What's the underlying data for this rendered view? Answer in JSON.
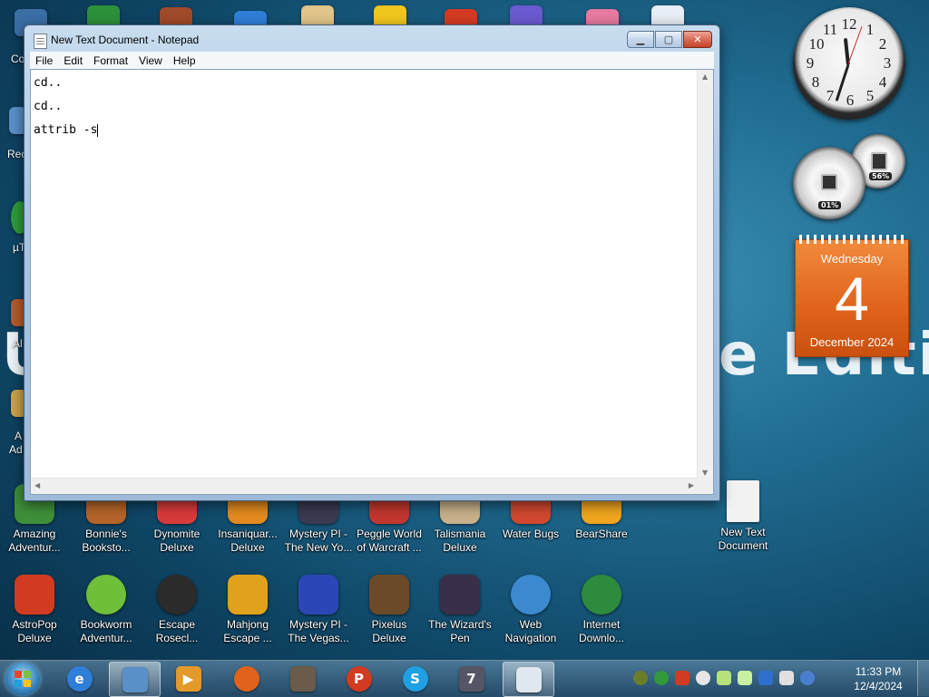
{
  "wallpaper": {
    "left_text": "U",
    "right_text": "e Edition"
  },
  "notepad": {
    "title": "New Text Document - Notepad",
    "menu": [
      "File",
      "Edit",
      "Format",
      "View",
      "Help"
    ],
    "lines": [
      "cd..",
      "cd..",
      "attrib -s"
    ]
  },
  "left_labels": [
    "Co",
    "Rec",
    "µT",
    "Al",
    "A",
    "Ad"
  ],
  "desktop_row1": [
    {
      "label": "Amazing Adventur...",
      "icon": "amazing-adventures-icon",
      "color": "#3e8f3a"
    },
    {
      "label": "Bonnie's Booksto...",
      "icon": "bonnies-bookstore-icon",
      "color": "#b5652a"
    },
    {
      "label": "Dynomite Deluxe",
      "icon": "dynomite-icon",
      "color": "#d83a3a"
    },
    {
      "label": "Insaniquar... Deluxe",
      "icon": "insaniquarium-icon",
      "color": "#e38a1f"
    },
    {
      "label": "Mystery PI - The New Yo...",
      "icon": "mystery-pi-ny-icon",
      "color": "#3a3a52"
    },
    {
      "label": "Peggle World of Warcraft ...",
      "icon": "peggle-wow-icon",
      "color": "#c2372f"
    },
    {
      "label": "Talismania Deluxe",
      "icon": "talismania-icon",
      "color": "#c7b08a"
    },
    {
      "label": "Water Bugs",
      "icon": "water-bugs-icon",
      "color": "#d1482f"
    },
    {
      "label": "BearShare",
      "icon": "bearshare-icon",
      "color": "#f0a51e"
    },
    {
      "label": "New Text Document",
      "icon": "text-document-icon",
      "color": "#f2f2f2"
    }
  ],
  "desktop_row2": [
    {
      "label": "AstroPop Deluxe",
      "icon": "astropop-icon",
      "color": "#d23b22"
    },
    {
      "label": "Bookworm Adventur...",
      "icon": "bookworm-icon",
      "color": "#6fbf3a"
    },
    {
      "label": "Escape Rosecl...",
      "icon": "escape-rosecliff-icon",
      "color": "#2b2b2b"
    },
    {
      "label": "Mahjong Escape ...",
      "icon": "mahjong-escape-icon",
      "color": "#e0a21c"
    },
    {
      "label": "Mystery PI - The Vegas...",
      "icon": "mystery-pi-vegas-icon",
      "color": "#2a47b5"
    },
    {
      "label": "Pixelus Deluxe",
      "icon": "pixelus-icon",
      "color": "#6b4a2a"
    },
    {
      "label": "The Wizard's Pen",
      "icon": "wizards-pen-icon",
      "color": "#3a2f4a"
    },
    {
      "label": "Web Navigation",
      "icon": "web-navigation-icon",
      "color": "#3c89d0"
    },
    {
      "label": "Internet Downlo...",
      "icon": "internet-download-icon",
      "color": "#2e8b3e"
    }
  ],
  "gadgets": {
    "clock": {
      "numbers": [
        "12",
        "1",
        "2",
        "3",
        "4",
        "5",
        "6",
        "7",
        "8",
        "9",
        "10",
        "11"
      ],
      "time": "11:33"
    },
    "cpu_meter": {
      "cpu": "01%",
      "memory": "56%"
    },
    "calendar": {
      "day": "Wednesday",
      "date": "4",
      "month": "December 2024"
    }
  },
  "taskbar": {
    "items": [
      {
        "name": "internet-explorer-icon",
        "color": "#2f7ed8",
        "glyph": "e"
      },
      {
        "name": "libraries-icon",
        "color": "#5a8fc7",
        "glyph": "",
        "active": true
      },
      {
        "name": "media-player-icon",
        "color": "#e39a2a",
        "glyph": "▶"
      },
      {
        "name": "firefox-icon",
        "color": "#e0621b",
        "glyph": ""
      },
      {
        "name": "raccoon-game-icon",
        "color": "#6b5b4a",
        "glyph": ""
      },
      {
        "name": "popcap-icon",
        "color": "#d23b22",
        "glyph": "P"
      },
      {
        "name": "skype-icon",
        "color": "#1ea0e2",
        "glyph": "S"
      },
      {
        "name": "winrar-icon",
        "color": "#555566",
        "glyph": "7"
      },
      {
        "name": "notepad-icon",
        "color": "#dfe7ef",
        "glyph": "",
        "active": true
      }
    ],
    "tray_colors": [
      "#6a7d2a",
      "#2f9a3a",
      "#d23b22",
      "#e6e6e6",
      "#b5e27a",
      "#c8f0a0",
      "#2f6fd0",
      "#e0e0e0",
      "#4a7fd0"
    ],
    "time": "11:33 PM",
    "date": "12/4/2024"
  }
}
